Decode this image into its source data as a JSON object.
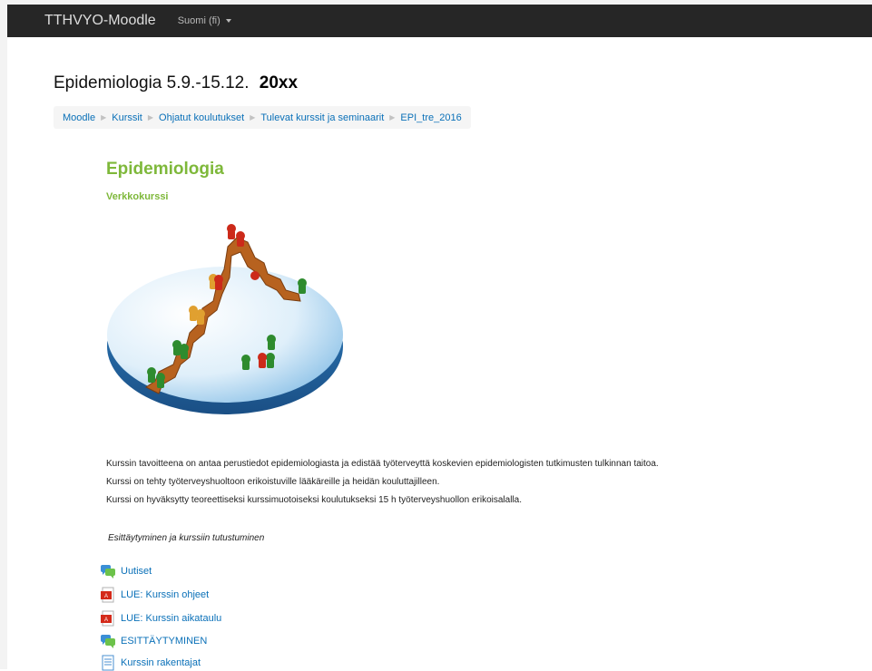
{
  "navbar": {
    "brand": "TTHVYO-Moodle",
    "language": "Suomi (fi)"
  },
  "course": {
    "title": "Epidemiologia 5.9.-15.12.",
    "year": "20xx"
  },
  "breadcrumb": [
    "Moodle",
    "Kurssit",
    "Ohjatut koulutukset",
    "Tulevat kurssit ja seminaarit",
    "EPI_tre_2016"
  ],
  "summary": {
    "heading": "Epidemiologia",
    "subheading": "Verkkokurssi",
    "paragraphs": [
      "Kurssin tavoitteena on antaa perustiedot epidemiologiasta ja edistää työterveyttä koskevien epidemiologisten tutkimusten tulkinnan taitoa.",
      "Kurssi on tehty työterveyshuoltoon erikoistuville lääkäreille ja heidän kouluttajilleen.",
      "Kurssi on hyväksytty teoreettiseksi kurssimuotoiseksi koulutukseksi 15 h työterveyshuollon erikoisalalla."
    ]
  },
  "section": {
    "title": "Esittäytyminen ja kurssiin tutustuminen",
    "activities": [
      {
        "icon": "forum-icon",
        "label": "Uutiset"
      },
      {
        "icon": "pdf-icon",
        "label": "LUE: Kurssin ohjeet"
      },
      {
        "icon": "pdf-icon",
        "label": "LUE: Kurssin aikataulu"
      },
      {
        "icon": "forum-icon",
        "label": "ESITTÄYTYMINEN"
      },
      {
        "icon": "page-icon",
        "label": "Kurssin rakentajat"
      }
    ]
  },
  "colors": {
    "navbar": "#262626",
    "link": "#0a70b8",
    "heading": "#7eb83a"
  }
}
